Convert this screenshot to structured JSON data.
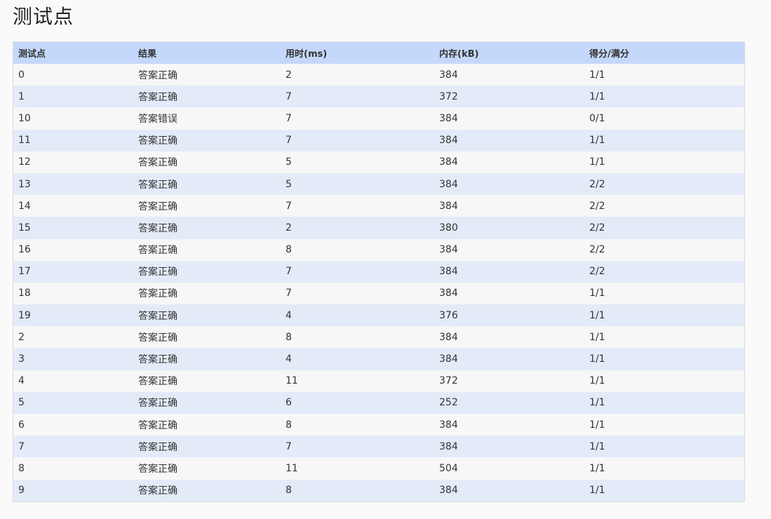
{
  "page": {
    "title": "测试点"
  },
  "colors": {
    "header_bg": "#c4d8fb",
    "row_odd_bg": "#f7f7f7",
    "row_even_bg": "#e3ebf9",
    "status_correct": "#e8000b",
    "status_wrong": "#1a8a1a"
  },
  "table": {
    "headers": {
      "case": "测试点",
      "result": "结果",
      "time": "用时(ms)",
      "memory": "内存(kB)",
      "score": "得分/满分"
    },
    "rows": [
      {
        "case": "0",
        "result": "答案正确",
        "status": "ok",
        "time": "2",
        "memory": "384",
        "score": "1/1"
      },
      {
        "case": "1",
        "result": "答案正确",
        "status": "ok",
        "time": "7",
        "memory": "372",
        "score": "1/1"
      },
      {
        "case": "10",
        "result": "答案错误",
        "status": "wrong",
        "time": "7",
        "memory": "384",
        "score": "0/1"
      },
      {
        "case": "11",
        "result": "答案正确",
        "status": "ok",
        "time": "7",
        "memory": "384",
        "score": "1/1"
      },
      {
        "case": "12",
        "result": "答案正确",
        "status": "ok",
        "time": "5",
        "memory": "384",
        "score": "1/1"
      },
      {
        "case": "13",
        "result": "答案正确",
        "status": "ok",
        "time": "5",
        "memory": "384",
        "score": "2/2"
      },
      {
        "case": "14",
        "result": "答案正确",
        "status": "ok",
        "time": "7",
        "memory": "384",
        "score": "2/2"
      },
      {
        "case": "15",
        "result": "答案正确",
        "status": "ok",
        "time": "2",
        "memory": "380",
        "score": "2/2"
      },
      {
        "case": "16",
        "result": "答案正确",
        "status": "ok",
        "time": "8",
        "memory": "384",
        "score": "2/2"
      },
      {
        "case": "17",
        "result": "答案正确",
        "status": "ok",
        "time": "7",
        "memory": "384",
        "score": "2/2"
      },
      {
        "case": "18",
        "result": "答案正确",
        "status": "ok",
        "time": "7",
        "memory": "384",
        "score": "1/1"
      },
      {
        "case": "19",
        "result": "答案正确",
        "status": "ok",
        "time": "4",
        "memory": "376",
        "score": "1/1"
      },
      {
        "case": "2",
        "result": "答案正确",
        "status": "ok",
        "time": "8",
        "memory": "384",
        "score": "1/1"
      },
      {
        "case": "3",
        "result": "答案正确",
        "status": "ok",
        "time": "4",
        "memory": "384",
        "score": "1/1"
      },
      {
        "case": "4",
        "result": "答案正确",
        "status": "ok",
        "time": "11",
        "memory": "372",
        "score": "1/1"
      },
      {
        "case": "5",
        "result": "答案正确",
        "status": "ok",
        "time": "6",
        "memory": "252",
        "score": "1/1"
      },
      {
        "case": "6",
        "result": "答案正确",
        "status": "ok",
        "time": "8",
        "memory": "384",
        "score": "1/1"
      },
      {
        "case": "7",
        "result": "答案正确",
        "status": "ok",
        "time": "7",
        "memory": "384",
        "score": "1/1"
      },
      {
        "case": "8",
        "result": "答案正确",
        "status": "ok",
        "time": "11",
        "memory": "504",
        "score": "1/1"
      },
      {
        "case": "9",
        "result": "答案正确",
        "status": "ok",
        "time": "8",
        "memory": "384",
        "score": "1/1"
      }
    ]
  }
}
